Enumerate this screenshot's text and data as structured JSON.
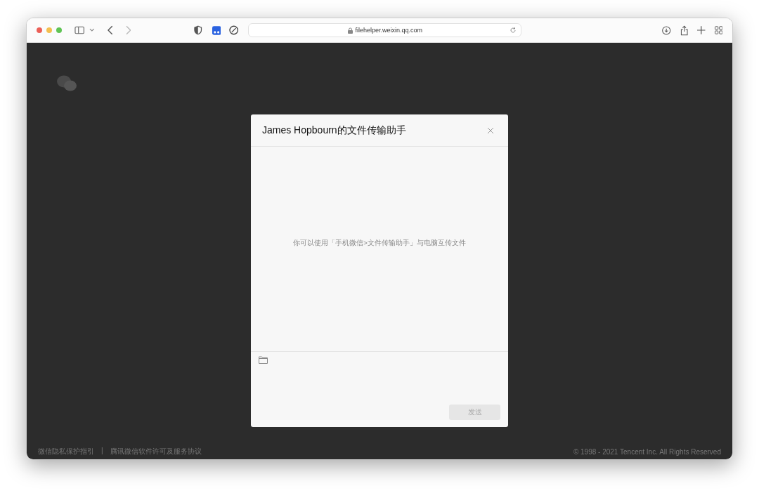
{
  "browser": {
    "address": "filehelper.weixin.qq.com"
  },
  "dialog": {
    "title": "James Hopbourn的文件传输助手",
    "empty_message": "你可以使用「手机微信>文件传输助手」与电脑互传文件",
    "send_button": {
      "label": "发送",
      "disabled": true
    }
  },
  "footer": {
    "links": [
      "微信隐私保护指引",
      "腾讯微信软件许可及服务协议"
    ],
    "separator": "|",
    "copyright": "© 1998 - 2021 Tencent Inc. All Rights Reserved"
  }
}
